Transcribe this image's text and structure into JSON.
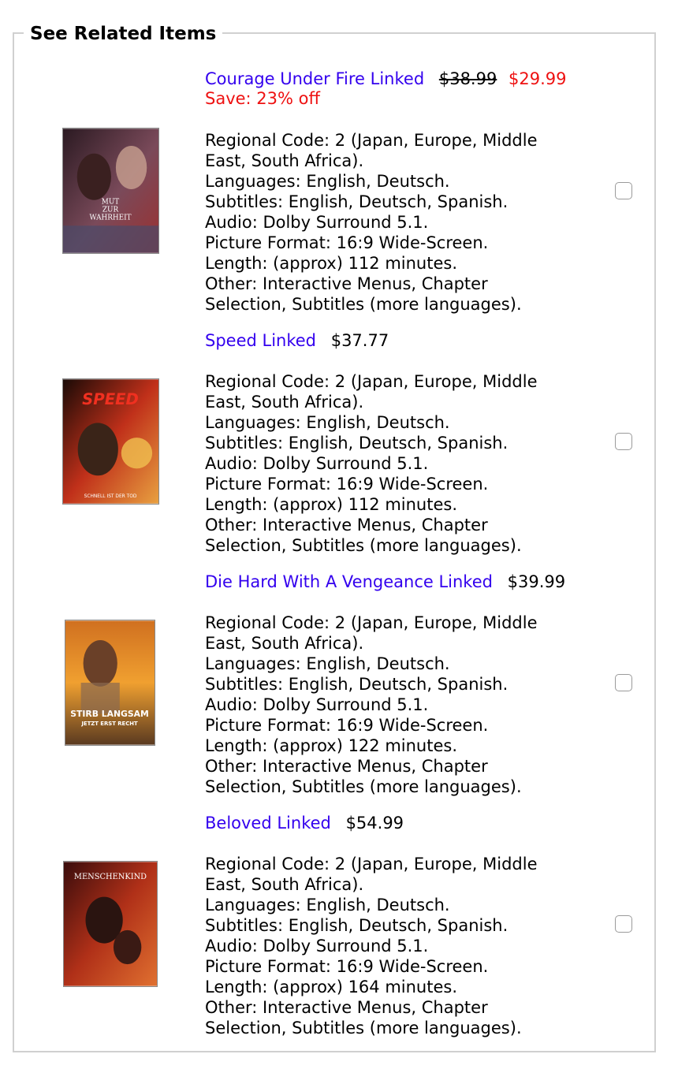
{
  "section": {
    "legend": "See Related Items"
  },
  "items": [
    {
      "title": "Courage Under Fire Linked",
      "old_price": "$38.99",
      "price": "$29.99",
      "save": "Save: 23% off",
      "details": [
        "Regional Code: 2 (Japan, Europe, Middle",
        "East, South Africa).",
        "Languages: English, Deutsch.",
        "Subtitles: English, Deutsch, Spanish.",
        "Audio: Dolby Surround 5.1.",
        "Picture Format: 16:9 Wide-Screen.",
        "Length: (approx) 112 minutes.",
        "Other: Interactive Menus, Chapter",
        "Selection, Subtitles (more languages)."
      ],
      "cover_text": [
        "MUT",
        "ZUR",
        "WAHRHEIT"
      ],
      "cover_colors": [
        "#2b1a22",
        "#7a4a5a",
        "#9b3030"
      ]
    },
    {
      "title": "Speed Linked",
      "price": "$37.77",
      "details": [
        "Regional Code: 2 (Japan, Europe, Middle",
        "East, South Africa).",
        "Languages: English, Deutsch.",
        "Subtitles: English, Deutsch, Spanish.",
        "Audio: Dolby Surround 5.1.",
        "Picture Format: 16:9 Wide-Screen.",
        "Length: (approx) 112 minutes.",
        "Other: Interactive Menus, Chapter",
        "Selection, Subtitles (more languages)."
      ],
      "cover_text": [
        "SPEED",
        "SCHNELL IST DER TOD"
      ],
      "cover_colors": [
        "#1a0a06",
        "#c0301a",
        "#e8a040"
      ]
    },
    {
      "title": "Die Hard With A Vengeance Linked",
      "price": "$39.99",
      "details": [
        "Regional Code: 2 (Japan, Europe, Middle",
        "East, South Africa).",
        "Languages: English, Deutsch.",
        "Subtitles: English, Deutsch, Spanish.",
        "Audio: Dolby Surround 5.1.",
        "Picture Format: 16:9 Wide-Screen.",
        "Length: (approx) 122 minutes.",
        "Other: Interactive Menus, Chapter",
        "Selection, Subtitles (more languages)."
      ],
      "cover_text": [
        "STIRB LANGSAM",
        "JETZT ERST RECHT"
      ],
      "cover_colors": [
        "#d07020",
        "#f0a030",
        "#5a3a20"
      ]
    },
    {
      "title": "Beloved Linked",
      "price": "$54.99",
      "details": [
        "Regional Code: 2 (Japan, Europe, Middle",
        "East, South Africa).",
        "Languages: English, Deutsch.",
        "Subtitles: English, Deutsch, Spanish.",
        "Audio: Dolby Surround 5.1.",
        "Picture Format: 16:9 Wide-Screen.",
        "Length: (approx) 164 minutes.",
        "Other: Interactive Menus, Chapter",
        "Selection, Subtitles (more languages)."
      ],
      "cover_text": [
        "MENSCHENKIND"
      ],
      "cover_colors": [
        "#3a0c0c",
        "#b03018",
        "#e07030"
      ]
    }
  ]
}
